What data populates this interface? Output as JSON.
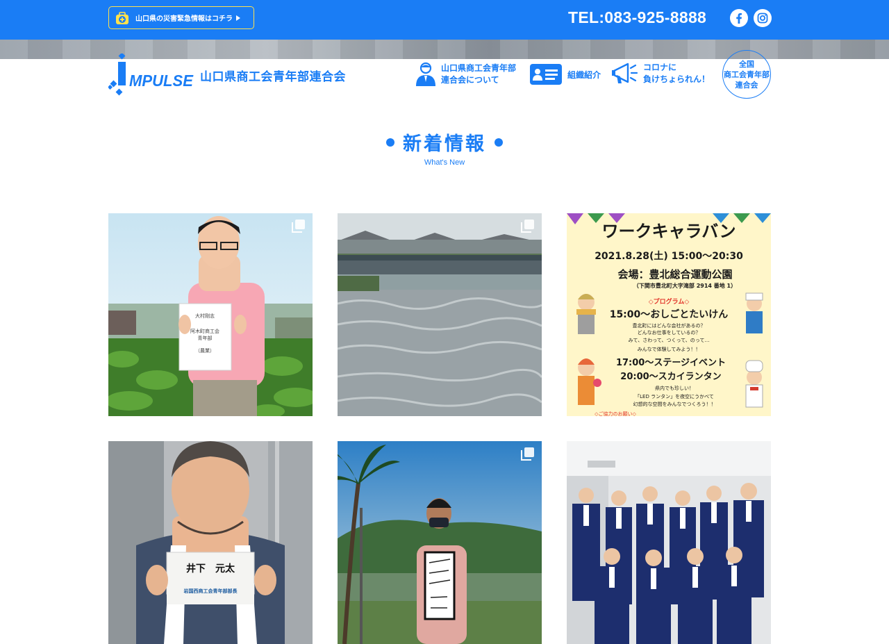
{
  "topbar": {
    "alert_label": "山口県の災害緊急情報はコチラ",
    "tel": "TEL:083-925-8888",
    "icons": [
      "first-aid-kit-icon",
      "facebook-icon",
      "instagram-icon"
    ]
  },
  "header": {
    "logo_text": "IMPULSE",
    "org_name": "山口県商工会青年部連合会",
    "nav": {
      "about_line1": "山口県商工会青年部",
      "about_line2": "連合会について",
      "org": "組織紹介",
      "corona_line1": "コロナに",
      "corona_line2": "負けちょられん！",
      "national_line1": "全国",
      "national_line2": "商工会青年部",
      "national_line3": "連合会"
    }
  },
  "section": {
    "title": "新着情報",
    "subtitle": "What's New"
  },
  "posts": [
    {
      "sign_line1": "大村剛志",
      "sign_line2": "阿木町商工会",
      "sign_line3": "青年部",
      "sign_line4": "（農業）"
    },
    {},
    {
      "line_top": "ワークキャラバン",
      "date": "2021.8.28(土) 15:00〜20:30",
      "venue": "会場：豊北総合運動公園",
      "address": "（下関市豊北町大字滝部 2914 番地 1）",
      "program_label": "◇プログラム◇",
      "prog1": "15:00〜おしごとたいけん",
      "prog1_desc1": "豊北町にはどんな会社があるの？",
      "prog1_desc2": "どんなお仕事をしているの？",
      "prog1_desc3": "みて、さわって、つくって、のって…",
      "prog1_desc4": "みんなで体験してみよう！！",
      "prog2": "17:00〜ステージイベント",
      "prog3": "20:00〜スカイランタン",
      "prog3_desc1": "県内でも珍しい！",
      "prog3_desc2": "「LED ランタン」を夜空にうかべて",
      "prog3_desc3": "幻想的な空間をみんなでつくろう！！",
      "footer_note": "◇ご協力のお願い◇"
    },
    {
      "name": "井下　元太",
      "role": "岩国西商工会青年部部長"
    },
    {},
    {}
  ]
}
